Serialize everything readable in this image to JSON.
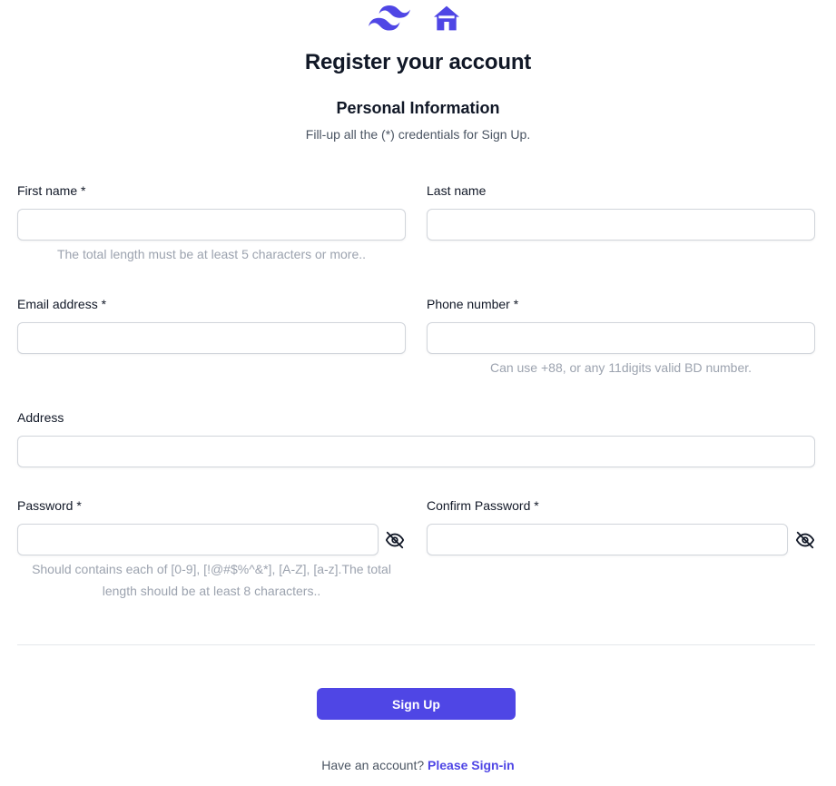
{
  "header": {
    "title": "Register your account",
    "section_title": "Personal Information",
    "description": "Fill-up all the (*) credentials for Sign Up.",
    "brand_color": "#4f46e5"
  },
  "form": {
    "first_name": {
      "label": "First name *",
      "value": "",
      "placeholder": "",
      "hint": "The total length must be at least 5 characters or more.."
    },
    "last_name": {
      "label": "Last name",
      "value": "",
      "placeholder": ""
    },
    "email": {
      "label": "Email address *",
      "value": "",
      "placeholder": ""
    },
    "phone": {
      "label": "Phone number *",
      "value": "",
      "placeholder": "",
      "hint": "Can use +88, or any 11digits valid BD number."
    },
    "address": {
      "label": "Address",
      "value": "",
      "placeholder": ""
    },
    "password": {
      "label": "Password *",
      "value": "",
      "placeholder": "",
      "hint_line1": "Should contains each of [0-9], [!@#$%^&*], [A-Z], [a-z].The total",
      "hint_line2": "length should be at least 8 characters..",
      "toggle_icon": "eye-off-icon"
    },
    "confirm_password": {
      "label": "Confirm Password *",
      "value": "",
      "placeholder": "",
      "toggle_icon": "eye-off-icon"
    }
  },
  "actions": {
    "signup_label": "Sign Up",
    "signin_prompt": "Have an account?",
    "signin_link": "Please Sign-in"
  },
  "icons": {
    "brand_logo": "wind-logo-icon",
    "home": "home-icon"
  }
}
